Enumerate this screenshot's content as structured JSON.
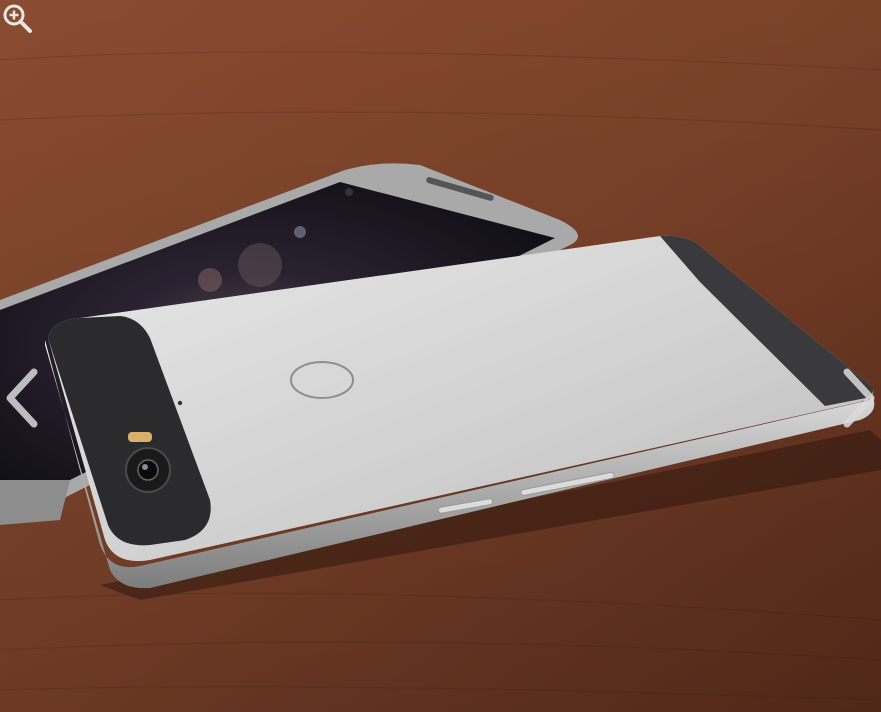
{
  "viewer": {
    "controls": {
      "zoom_icon": "magnifier-plus-icon",
      "prev_icon": "chevron-left-icon",
      "next_icon": "chevron-right-icon"
    },
    "photo": {
      "subject": "smartphone-render",
      "colors": {
        "table": "#7a4129",
        "phone_body": "#cfcfcf",
        "camera_bar": "#2b2b2d",
        "screen": "#1a1a22"
      }
    }
  }
}
